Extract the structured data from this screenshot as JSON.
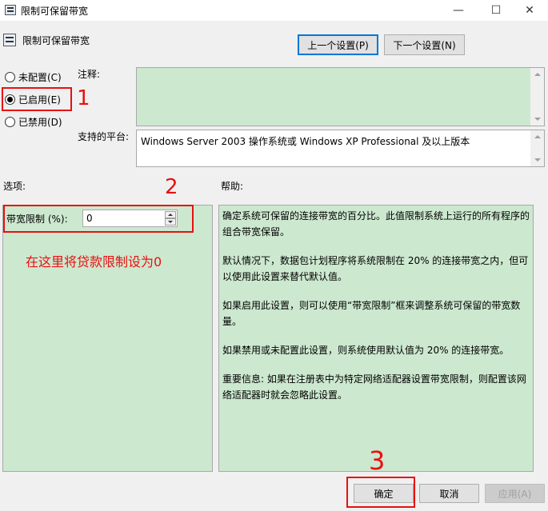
{
  "window": {
    "title": "限制可保留带宽",
    "minimize": "—",
    "maximize": "☐",
    "close": "✕"
  },
  "header": {
    "title": "限制可保留带宽",
    "prev_button": "上一个设置(P)",
    "next_button": "下一个设置(N)"
  },
  "state": {
    "options": [
      {
        "label": "未配置(C)",
        "checked": false
      },
      {
        "label": "已启用(E)",
        "checked": true
      },
      {
        "label": "已禁用(D)",
        "checked": false
      }
    ]
  },
  "comment": {
    "label": "注释:",
    "value": ""
  },
  "platform": {
    "label": "支持的平台:",
    "value": "Windows Server 2003 操作系统或 Windows XP Professional 及以上版本"
  },
  "options_section": {
    "label": "选项:",
    "bandwidth_label": "带宽限制 (%):",
    "bandwidth_value": "0"
  },
  "help_section": {
    "label": "帮助:",
    "paragraphs": [
      "确定系统可保留的连接带宽的百分比。此值限制系统上运行的所有程序的组合带宽保留。",
      "默认情况下，数据包计划程序将系统限制在 20% 的连接带宽之内，但可以使用此设置来替代默认值。",
      "如果启用此设置，则可以使用“带宽限制”框来调整系统可保留的带宽数量。",
      "如果禁用或未配置此设置，则系统使用默认值为 20% 的连接带宽。",
      "重要信息: 如果在注册表中为特定网络适配器设置带宽限制，则配置该网络适配器时就会忽略此设置。"
    ]
  },
  "footer": {
    "ok": "确定",
    "cancel": "取消",
    "apply": "应用(A)"
  },
  "annotations": {
    "step1": "1",
    "step2": "2",
    "step3": "3",
    "note": "在这里将贷款限制设为0"
  },
  "colors": {
    "field_green": "#cce8cf",
    "annotation_red": "#e81010",
    "focus_blue": "#0078d7"
  }
}
